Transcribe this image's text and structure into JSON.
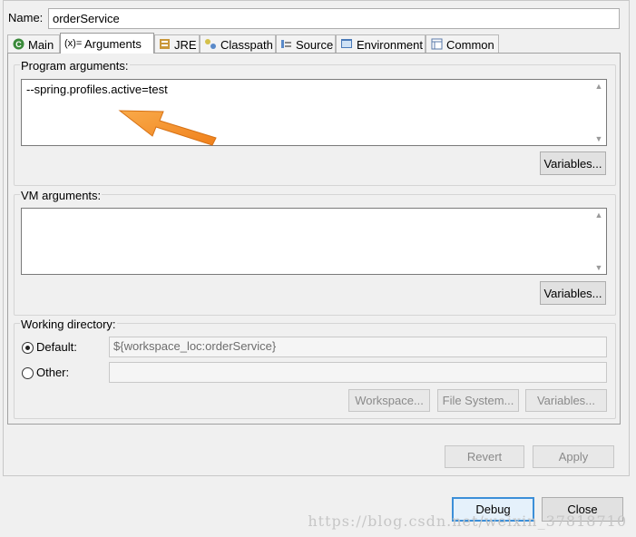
{
  "name_label": "Name:",
  "name_value": "orderService",
  "tabs": [
    {
      "label": "Main",
      "icon": "main-icon"
    },
    {
      "label": "Arguments",
      "icon": "arguments-icon"
    },
    {
      "label": "JRE",
      "icon": "jre-icon"
    },
    {
      "label": "Classpath",
      "icon": "classpath-icon"
    },
    {
      "label": "Source",
      "icon": "source-icon"
    },
    {
      "label": "Environment",
      "icon": "environment-icon"
    },
    {
      "label": "Common",
      "icon": "common-icon"
    }
  ],
  "program_args": {
    "label": "Program arguments:",
    "value": "--spring.profiles.active=test",
    "variables_button": "Variables..."
  },
  "vm_args": {
    "label": "VM arguments:",
    "value": "",
    "variables_button": "Variables..."
  },
  "working_directory": {
    "label": "Working directory:",
    "default_label": "Default:",
    "default_value": "${workspace_loc:orderService}",
    "other_label": "Other:",
    "other_value": "",
    "workspace_button": "Workspace...",
    "filesystem_button": "File System...",
    "variables_button": "Variables..."
  },
  "footer": {
    "revert": "Revert",
    "apply": "Apply",
    "debug": "Debug",
    "close": "Close"
  },
  "watermark": "https://blog.csdn.net/weixin_37818710",
  "colors": {
    "arrow": "#f5901e",
    "accent": "#3c8fd8"
  }
}
